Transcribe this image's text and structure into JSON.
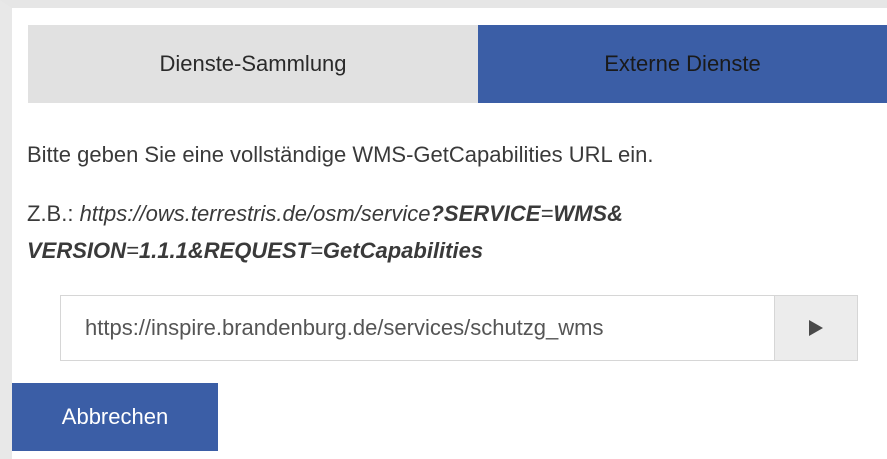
{
  "tabs": [
    {
      "label": "Dienste-Sammlung",
      "active": false
    },
    {
      "label": "Externe Dienste",
      "active": true
    }
  ],
  "instruction": "Bitte geben Sie eine vollständige WMS-GetCapabilities URL ein.",
  "example": {
    "prefix": "Z.B.: ",
    "url_base": "https://ows.terrestris.de/osm/service",
    "q1": "?SERVICE",
    "eq1": "=",
    "v1": "WMS&",
    "q2": "VERSION",
    "eq2": "=",
    "v2": "1.1.1&REQUEST",
    "eq3": "=",
    "v3": "GetCapabilities"
  },
  "url_input": {
    "value": "https://inspire.brandenburg.de/services/schutzg_wms"
  },
  "go_button": {
    "icon": "play-icon"
  },
  "cancel_button": {
    "label": "Abbrechen"
  },
  "colors": {
    "accent": "#3b5ea6",
    "tab_inactive": "#e1e1e1",
    "go_button": "#ececec"
  }
}
